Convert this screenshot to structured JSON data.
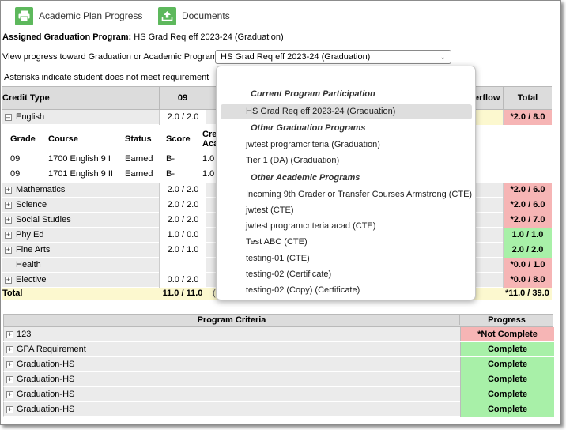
{
  "toolbar": {
    "academic_plan_progress": "Academic Plan Progress",
    "documents": "Documents"
  },
  "assigned": {
    "label": "Assigned Graduation Program:",
    "value": "HS Grad Req eff 2023-24 (Graduation)"
  },
  "view_progress": {
    "label": "View progress toward Graduation or Academic Program:",
    "selected": "HS Grad Req eff 2023-24 (Graduation)"
  },
  "asterisk_note": "Asterisks indicate student does not meet requirement",
  "grid": {
    "headers": {
      "credit_type": "Credit Type",
      "year_09": "09",
      "overflow": "erflow",
      "total": "Total"
    },
    "english": {
      "name": "English",
      "col09": "2.0 / 2.0",
      "total": "*2.0 / 8.0"
    },
    "course_headers": {
      "grade": "Grade",
      "course": "Course",
      "status": "Status",
      "score": "Score",
      "cred_1": "Cre",
      "cred_2": "Aca"
    },
    "courses": [
      {
        "grade": "09",
        "course": "1700 English 9 I",
        "status": "Earned",
        "score": "B-",
        "cred": "1.0"
      },
      {
        "grade": "09",
        "course": "1701 English 9 II",
        "status": "Earned",
        "score": "B-",
        "cred": "1.0"
      }
    ],
    "rows": [
      {
        "name": "Mathematics",
        "col09": "2.0 / 2.0",
        "total": "*2.0 / 6.0"
      },
      {
        "name": "Science",
        "col09": "2.0 / 2.0",
        "total": "*2.0 / 6.0"
      },
      {
        "name": "Social Studies",
        "col09": "2.0 / 2.0",
        "total": "*2.0 / 7.0"
      },
      {
        "name": "Phy Ed",
        "col09": "1.0 / 0.0",
        "total": "1.0 / 1.0"
      },
      {
        "name": "Fine Arts",
        "col09": "2.0 / 1.0",
        "total": "2.0 / 2.0"
      },
      {
        "name": "Health",
        "col09": "",
        "total": "*0.0 / 1.0"
      },
      {
        "name": "Elective",
        "col09": "0.0 / 2.0",
        "total": "*0.0 / 8.0"
      }
    ],
    "total_row": {
      "name": "Total",
      "col09": "11.0 / 11.0",
      "partial": "(",
      "total": "*11.0 / 39.0"
    }
  },
  "dropdown": {
    "group_current": "Current Program Participation",
    "current_options": [
      "HS Grad Req eff 2023-24 (Graduation)"
    ],
    "group_other_grad": "Other Graduation Programs",
    "other_grad_options": [
      "jwtest programcriteria (Graduation)",
      "Tier 1 (DA) (Graduation)"
    ],
    "group_other_academic": "Other Academic Programs",
    "other_academic_options": [
      "Incoming 9th Grader or Transfer Courses Armstrong (CTE)",
      "jwtest (CTE)",
      "jwtest programcriteria acad (CTE)",
      "Test ABC (CTE)",
      "testing-01 (CTE)",
      "testing-02 (Certificate)",
      "testing-02 (Copy) (Certificate)"
    ]
  },
  "criteria": {
    "headers": {
      "program_criteria": "Program Criteria",
      "progress": "Progress"
    },
    "rows": [
      {
        "name": "123",
        "progress": "*Not Complete"
      },
      {
        "name": "GPA Requirement",
        "progress": "Complete"
      },
      {
        "name": "Graduation-HS",
        "progress": "Complete"
      },
      {
        "name": "Graduation-HS",
        "progress": "Complete"
      },
      {
        "name": "Graduation-HS",
        "progress": "Complete"
      },
      {
        "name": "Graduation-HS",
        "progress": "Complete"
      }
    ]
  },
  "colors": {
    "toolbar_icon": "#5db85c",
    "fail": "#f6b5b5",
    "pass": "#a8f0a8",
    "total_highlight": "#fcf8cf"
  }
}
